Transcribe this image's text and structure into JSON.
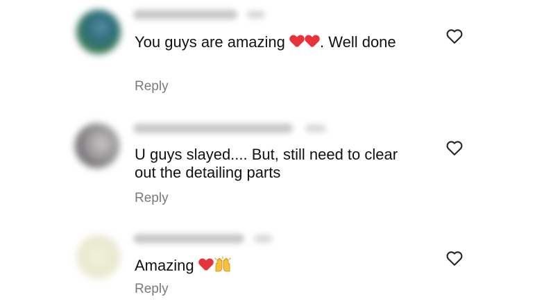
{
  "comments": [
    {
      "text_before": "You guys are amazing ",
      "text_after": ". Well done",
      "emojis": [
        "red-heart",
        "red-heart"
      ],
      "reply_label": "Reply"
    },
    {
      "text": "U guys slayed.... But, still need to clear out the detailing parts",
      "reply_label": "Reply"
    },
    {
      "text_before": "Amazing ",
      "emojis": [
        "red-heart",
        "raising-hands"
      ],
      "reply_label": "Reply"
    }
  ],
  "icons": {
    "like": "heart-outline-icon",
    "heart_emoji": "red-heart-emoji-icon",
    "hands_emoji": "raising-hands-emoji-icon"
  },
  "colors": {
    "text": "#111111",
    "reply": "#7a7a7a",
    "heart_emoji": "#e8333a",
    "like_outline": "#262626"
  }
}
